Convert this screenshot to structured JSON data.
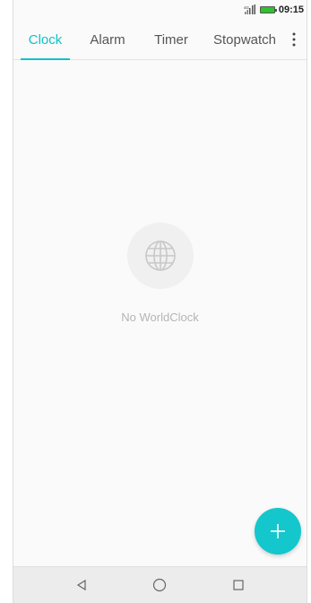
{
  "status_bar": {
    "network_label": "4G",
    "time": "09:15",
    "battery_color": "#2fc22f"
  },
  "tabs": [
    {
      "label": "Clock",
      "active": true
    },
    {
      "label": "Alarm",
      "active": false
    },
    {
      "label": "Timer",
      "active": false
    },
    {
      "label": "Stopwatch",
      "active": false
    }
  ],
  "empty_state": {
    "icon": "globe-icon",
    "text": "No WorldClock"
  },
  "fab": {
    "icon": "plus-icon",
    "color": "#13c7cc"
  },
  "nav": {
    "back_icon": "back-triangle-icon",
    "home_icon": "home-circle-icon",
    "recents_icon": "recents-square-icon"
  },
  "colors": {
    "accent": "#11c2c7",
    "tab_inactive": "#555555",
    "empty_text": "#b5b5b5"
  }
}
